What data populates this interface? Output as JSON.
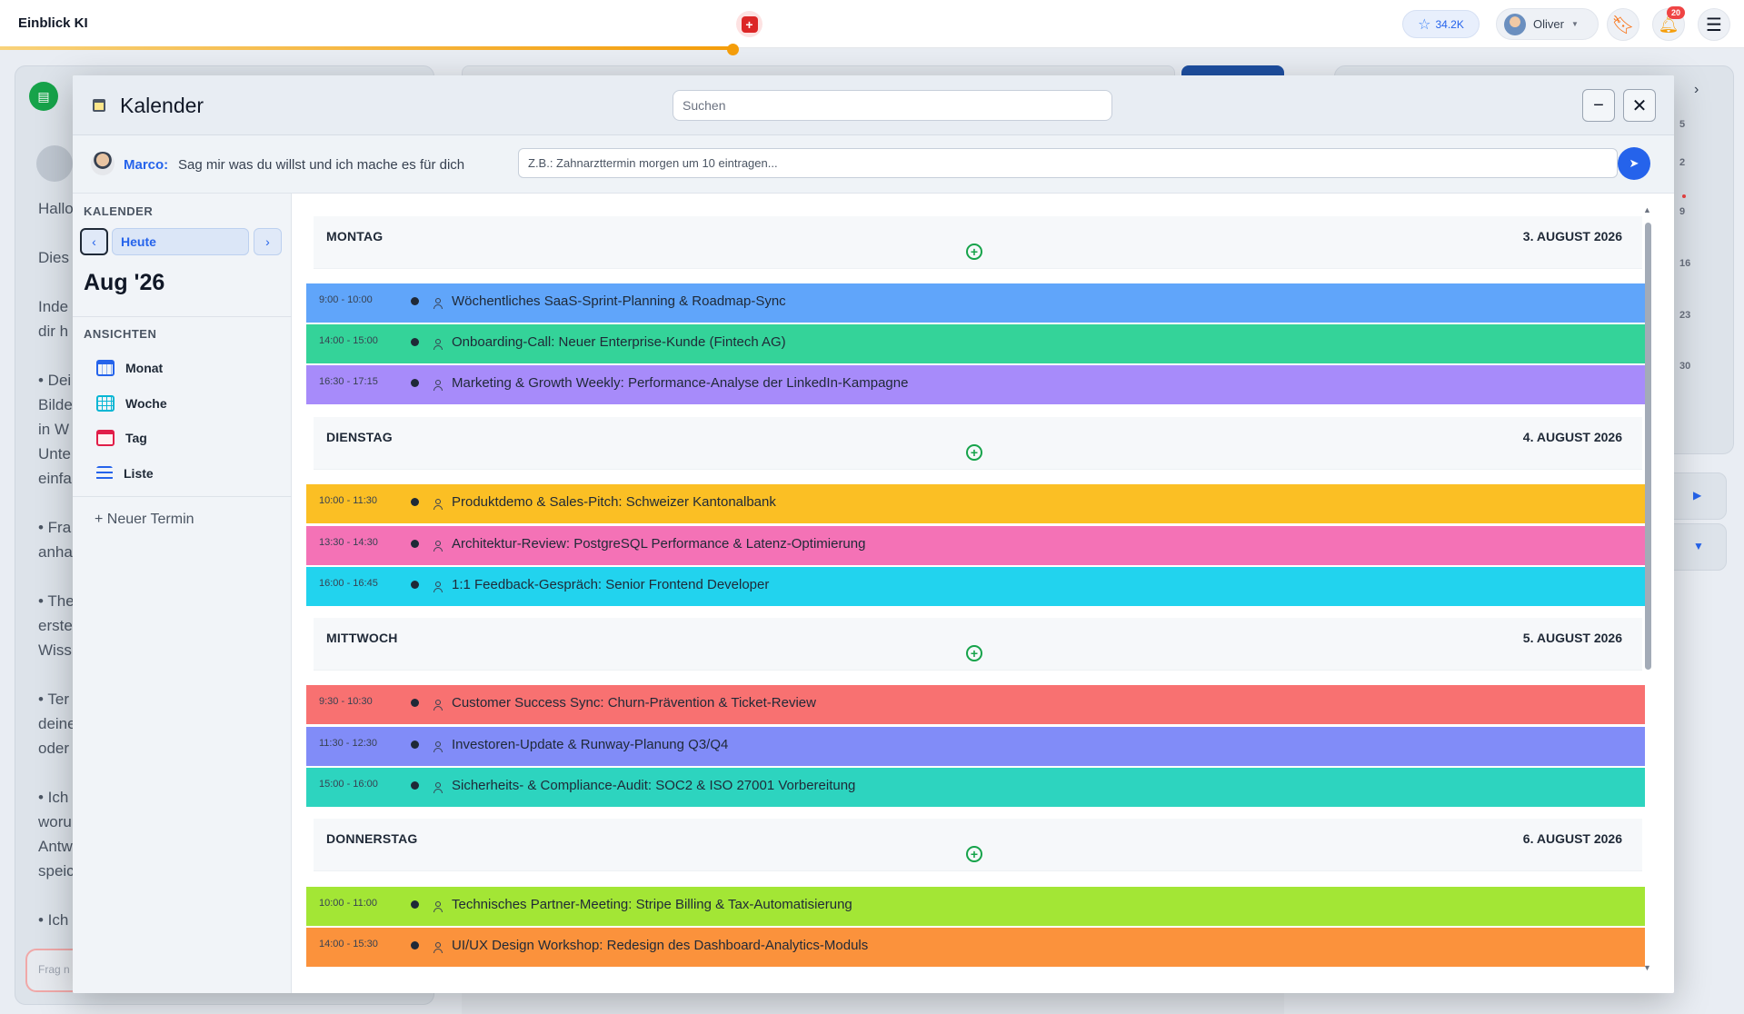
{
  "topbar": {
    "brand": "Einblick KI",
    "stars": "34.2K",
    "user_name": "Oliver",
    "notification_count": "20"
  },
  "background": {
    "left_texts": [
      "Hallo",
      "Dies",
      "Inde",
      "dir h",
      "• Dei",
      "Bilde",
      "in W",
      "Unte",
      "einfa",
      "• Fra",
      "anha",
      "• The",
      "erste",
      "Wiss",
      "• Ter",
      "deine",
      "oder",
      "• Ich",
      "woru",
      "Antw",
      "speic",
      "• Ich"
    ],
    "input_placeholder": "Frag n",
    "right_numbers": [
      "5",
      "2",
      "9",
      "16",
      "23",
      "30"
    ]
  },
  "modal": {
    "title": "Kalender",
    "search_placeholder": "Suchen",
    "minimize_label": "−",
    "close_label": "✕",
    "assistant": {
      "name": "Marco:",
      "message": "Sag mir was du willst und ich mache es für dich",
      "input_placeholder": "Z.B.: Zahnarzttermin morgen um 10 eintragen..."
    },
    "sidebar": {
      "heading": "KALENDER",
      "prev": "‹",
      "today": "Heute",
      "next": "›",
      "month": "Aug '26",
      "views_heading": "ANSICHTEN",
      "views": [
        {
          "label": "Monat",
          "icon": "calendar-month-icon"
        },
        {
          "label": "Woche",
          "icon": "calendar-week-icon"
        },
        {
          "label": "Tag",
          "icon": "calendar-day-icon"
        },
        {
          "label": "Liste",
          "icon": "list-icon"
        }
      ],
      "new_event": "+ Neuer Termin"
    },
    "days": [
      {
        "name": "MONTAG",
        "date": "3. AUGUST 2026",
        "events": [
          {
            "time": "9:00 - 10:00",
            "title": "Wöchentliches SaaS-Sprint-Planning & Roadmap-Sync",
            "color": "#60a5fa"
          },
          {
            "time": "14:00 - 15:00",
            "title": "Onboarding-Call: Neuer Enterprise-Kunde (Fintech AG)",
            "color": "#34d399"
          },
          {
            "time": "16:30 - 17:15",
            "title": "Marketing & Growth Weekly: Performance-Analyse der LinkedIn-Kampagne",
            "color": "#a78bfa"
          }
        ]
      },
      {
        "name": "DIENSTAG",
        "date": "4. AUGUST 2026",
        "events": [
          {
            "time": "10:00 - 11:30",
            "title": "Produktdemo & Sales-Pitch: Schweizer Kantonalbank",
            "color": "#fbbf24"
          },
          {
            "time": "13:30 - 14:30",
            "title": "Architektur-Review: PostgreSQL Performance & Latenz-Optimierung",
            "color": "#f472b6"
          },
          {
            "time": "16:00 - 16:45",
            "title": "1:1 Feedback-Gespräch: Senior Frontend Developer",
            "color": "#22d3ee"
          }
        ]
      },
      {
        "name": "MITTWOCH",
        "date": "5. AUGUST 2026",
        "events": [
          {
            "time": "9:30 - 10:30",
            "title": "Customer Success Sync: Churn-Prävention & Ticket-Review",
            "color": "#f87171"
          },
          {
            "time": "11:30 - 12:30",
            "title": "Investoren-Update & Runway-Planung Q3/Q4",
            "color": "#818cf8"
          },
          {
            "time": "15:00 - 16:00",
            "title": "Sicherheits- & Compliance-Audit: SOC2 & ISO 27001 Vorbereitung",
            "color": "#2dd4bf"
          }
        ]
      },
      {
        "name": "DONNERSTAG",
        "date": "6. AUGUST 2026",
        "events": [
          {
            "time": "10:00 - 11:00",
            "title": "Technisches Partner-Meeting: Stripe Billing & Tax-Automatisierung",
            "color": "#a3e635"
          },
          {
            "time": "14:00 - 15:30",
            "title": "UI/UX Design Workshop: Redesign des Dashboard-Analytics-Moduls",
            "color": "#fb923c"
          }
        ]
      }
    ]
  }
}
